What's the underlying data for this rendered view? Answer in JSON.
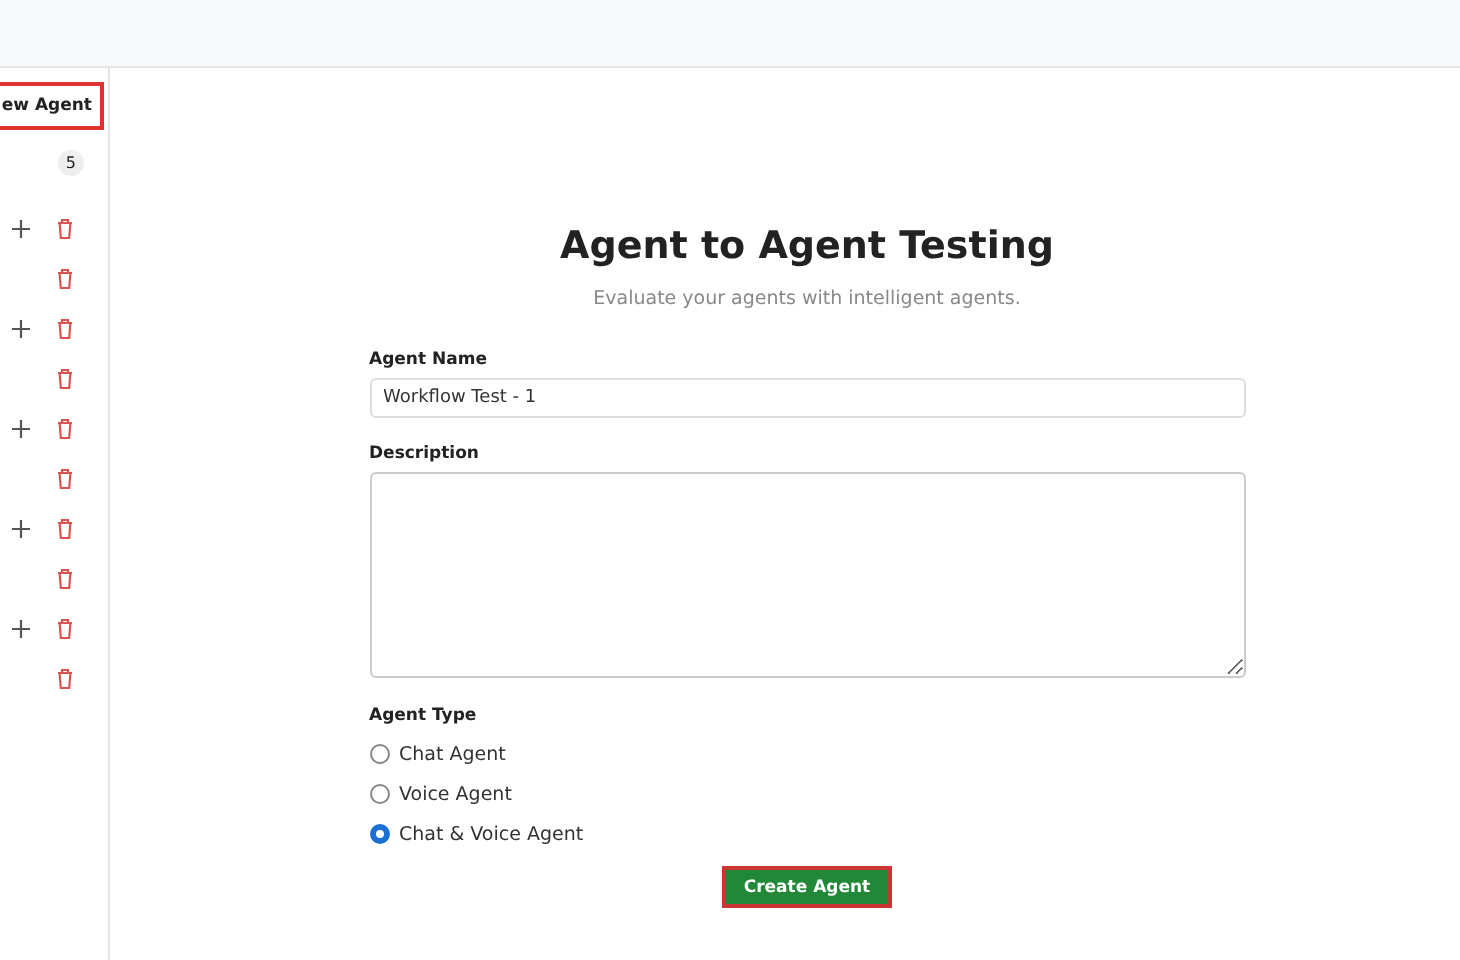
{
  "sidebar": {
    "new_agent_button": "ew Agent",
    "count": "5",
    "rows": [
      {
        "kind": "add-delete"
      },
      {
        "kind": "delete"
      },
      {
        "kind": "add-delete"
      },
      {
        "kind": "delete"
      },
      {
        "kind": "add-delete"
      },
      {
        "kind": "delete"
      },
      {
        "kind": "add-delete"
      },
      {
        "kind": "delete"
      },
      {
        "kind": "add-delete"
      },
      {
        "kind": "delete"
      }
    ]
  },
  "form": {
    "title": "Agent to Agent Testing",
    "subtitle": "Evaluate your agents with intelligent agents.",
    "name_label": "Agent Name",
    "name_value": "Workflow Test - 1",
    "description_label": "Description",
    "type_label": "Agent Type",
    "types": [
      {
        "label": "Chat Agent",
        "selected": false
      },
      {
        "label": "Voice Agent",
        "selected": false
      },
      {
        "label": "Chat & Voice Agent",
        "selected": true
      }
    ],
    "submit_button": "Create Agent"
  }
}
